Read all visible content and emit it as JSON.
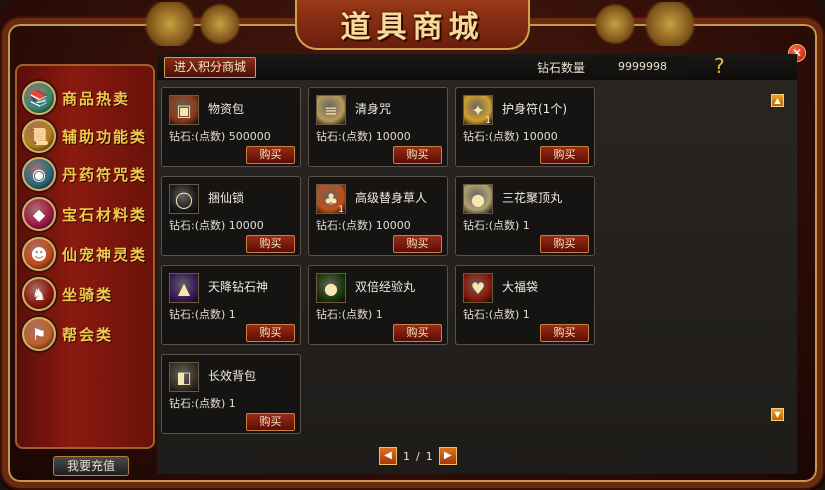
{
  "title": "道具商城",
  "close_glyph": "✕",
  "sidebar": {
    "items": [
      {
        "label": "商品热卖",
        "icon": "books-icon",
        "color": "#3a8a6a",
        "glyph": "📚"
      },
      {
        "label": "辅助功能类",
        "icon": "scroll-icon",
        "color": "#b0801a",
        "glyph": "📜"
      },
      {
        "label": "丹药符咒类",
        "icon": "orb-icon",
        "color": "#2a6a7a",
        "glyph": "◉"
      },
      {
        "label": "宝石材料类",
        "icon": "gem-icon",
        "color": "#a01a4a",
        "glyph": "◆"
      },
      {
        "label": "仙宠神灵类",
        "icon": "pet-icon",
        "color": "#c04a1a",
        "glyph": "☻"
      },
      {
        "label": "坐骑类",
        "icon": "mount-icon",
        "color": "#8a1a0a",
        "glyph": "♞"
      },
      {
        "label": "帮会类",
        "icon": "guild-icon",
        "color": "#c0602a",
        "glyph": "⚑"
      }
    ],
    "recharge_label": "我要充值"
  },
  "top_bar": {
    "points_tab_label": "进入积分商城",
    "diamond_label": "钻石数量",
    "diamond_value": "9999998",
    "help_glyph": "?"
  },
  "items": [
    {
      "name": "物资包",
      "price": "钻石:(点数) 500000",
      "buy": "购买",
      "icon": "treasure-chest-icon",
      "glyph": "▣",
      "color": "#8a3a1a",
      "qty": ""
    },
    {
      "name": "清身咒",
      "price": "钻石:(点数) 10000",
      "buy": "购买",
      "icon": "scroll-icon",
      "glyph": "≡",
      "color": "#b89a5a",
      "qty": ""
    },
    {
      "name": "护身符(1个)",
      "price": "钻石:(点数) 10000",
      "buy": "购买",
      "icon": "talisman-icon",
      "glyph": "✦",
      "color": "#d0a030",
      "qty": "1"
    },
    {
      "name": "捆仙锁",
      "price": "钻石:(点数) 10000",
      "buy": "购买",
      "icon": "lock-icon",
      "glyph": "◯",
      "color": "#1a1a1a",
      "qty": ""
    },
    {
      "name": "高级替身草人",
      "price": "钻石:(点数) 10000",
      "buy": "购买",
      "icon": "straw-doll-icon",
      "glyph": "♣",
      "color": "#c0501a",
      "qty": "1"
    },
    {
      "name": "三花聚顶丸",
      "price": "钻石:(点数) 1",
      "buy": "购买",
      "icon": "pill-icon",
      "glyph": "●",
      "color": "#b0a070",
      "qty": ""
    },
    {
      "name": "天降钻石神",
      "price": "钻石:(点数) 1",
      "buy": "购买",
      "icon": "purple-gem-icon",
      "glyph": "▲",
      "color": "#3a1a5a",
      "qty": ""
    },
    {
      "name": "双倍经验丸",
      "price": "钻石:(点数) 1",
      "buy": "购买",
      "icon": "green-pill-icon",
      "glyph": "●",
      "color": "#1a3a0a",
      "qty": ""
    },
    {
      "name": "大福袋",
      "price": "钻石:(点数) 1",
      "buy": "购买",
      "icon": "lucky-bag-icon",
      "glyph": "♥",
      "color": "#8a1a0a",
      "qty": ""
    },
    {
      "name": "长效背包",
      "price": "钻石:(点数) 1",
      "buy": "购买",
      "icon": "backpack-icon",
      "glyph": "◧",
      "color": "#3a3028",
      "qty": ""
    }
  ],
  "pagination": {
    "current": "1",
    "separator": "/",
    "total": "1",
    "prev_glyph": "◀",
    "next_glyph": "▶"
  },
  "scroll": {
    "up_glyph": "▲",
    "down_glyph": "▼"
  }
}
